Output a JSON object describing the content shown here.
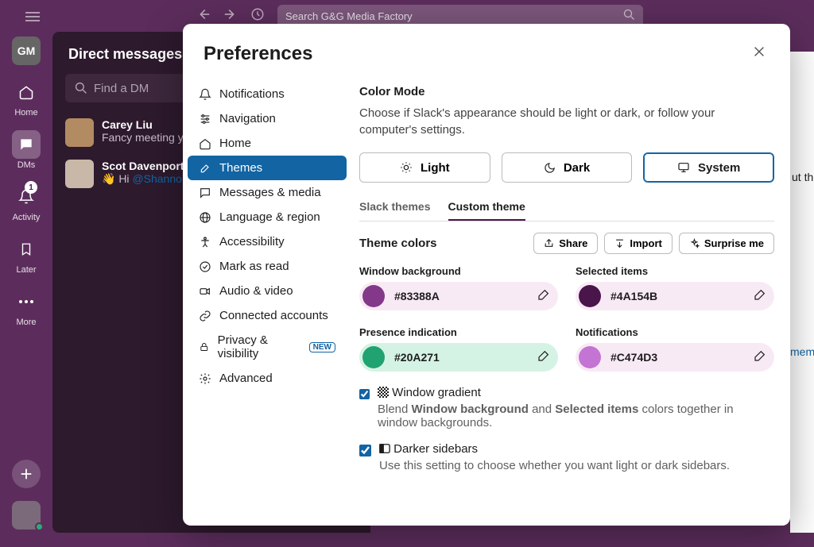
{
  "top": {
    "search_placeholder": "Search G&G Media Factory",
    "workspace_initials": "GM"
  },
  "rail": {
    "home": "Home",
    "dms": "DMs",
    "activity": "Activity",
    "activity_badge": "1",
    "later": "Later",
    "more": "More"
  },
  "dm": {
    "header": "Direct messages",
    "search_placeholder": "Find a DM",
    "rows": [
      {
        "name": "Carey Liu",
        "preview": "Fancy meeting yo"
      },
      {
        "name": "Scot Davenport",
        "preview_pre": "👋 Hi ",
        "mention": "@Shanno"
      }
    ]
  },
  "modal": {
    "title": "Preferences",
    "nav": {
      "notifications": "Notifications",
      "navigation": "Navigation",
      "home": "Home",
      "themes": "Themes",
      "messages_media": "Messages & media",
      "language_region": "Language & region",
      "accessibility": "Accessibility",
      "mark_as_read": "Mark as read",
      "audio_video": "Audio & video",
      "connected_accounts": "Connected accounts",
      "privacy_visibility": "Privacy & visibility",
      "new_badge": "NEW",
      "advanced": "Advanced"
    },
    "content": {
      "color_mode_h": "Color Mode",
      "color_mode_desc": "Choose if Slack's appearance should be light or dark, or follow your computer's settings.",
      "modes": {
        "light": "Light",
        "dark": "Dark",
        "system": "System"
      },
      "tabs": {
        "slack": "Slack themes",
        "custom": "Custom theme"
      },
      "theme_colors_h": "Theme colors",
      "actions": {
        "share": "Share",
        "import": "Import",
        "surprise": "Surprise me"
      },
      "colors": {
        "window_bg": {
          "label": "Window background",
          "hex": "#83388A",
          "swatch": "#83388A",
          "pill": "#F8EAF5"
        },
        "selected": {
          "label": "Selected items",
          "hex": "#4A154B",
          "swatch": "#4A154B",
          "pill": "#F8EAF5"
        },
        "presence": {
          "label": "Presence indication",
          "hex": "#20A271",
          "swatch": "#20A271",
          "pill": "#D5F3E4"
        },
        "notifications": {
          "label": "Notifications",
          "hex": "#C474D3",
          "swatch": "#C474D3",
          "pill": "#F8EAF5"
        }
      },
      "gradient": {
        "title": "Window gradient",
        "desc_a": "Blend ",
        "desc_b": "Window background",
        "desc_c": " and ",
        "desc_d": "Selected items",
        "desc_e": " colors together in window backgrounds."
      },
      "darker": {
        "title": "Darker sidebars",
        "desc": "Use this setting to choose whether you want light or dark sidebars."
      }
    }
  },
  "right_peek": {
    "a": "ut th",
    "b": "mem"
  }
}
